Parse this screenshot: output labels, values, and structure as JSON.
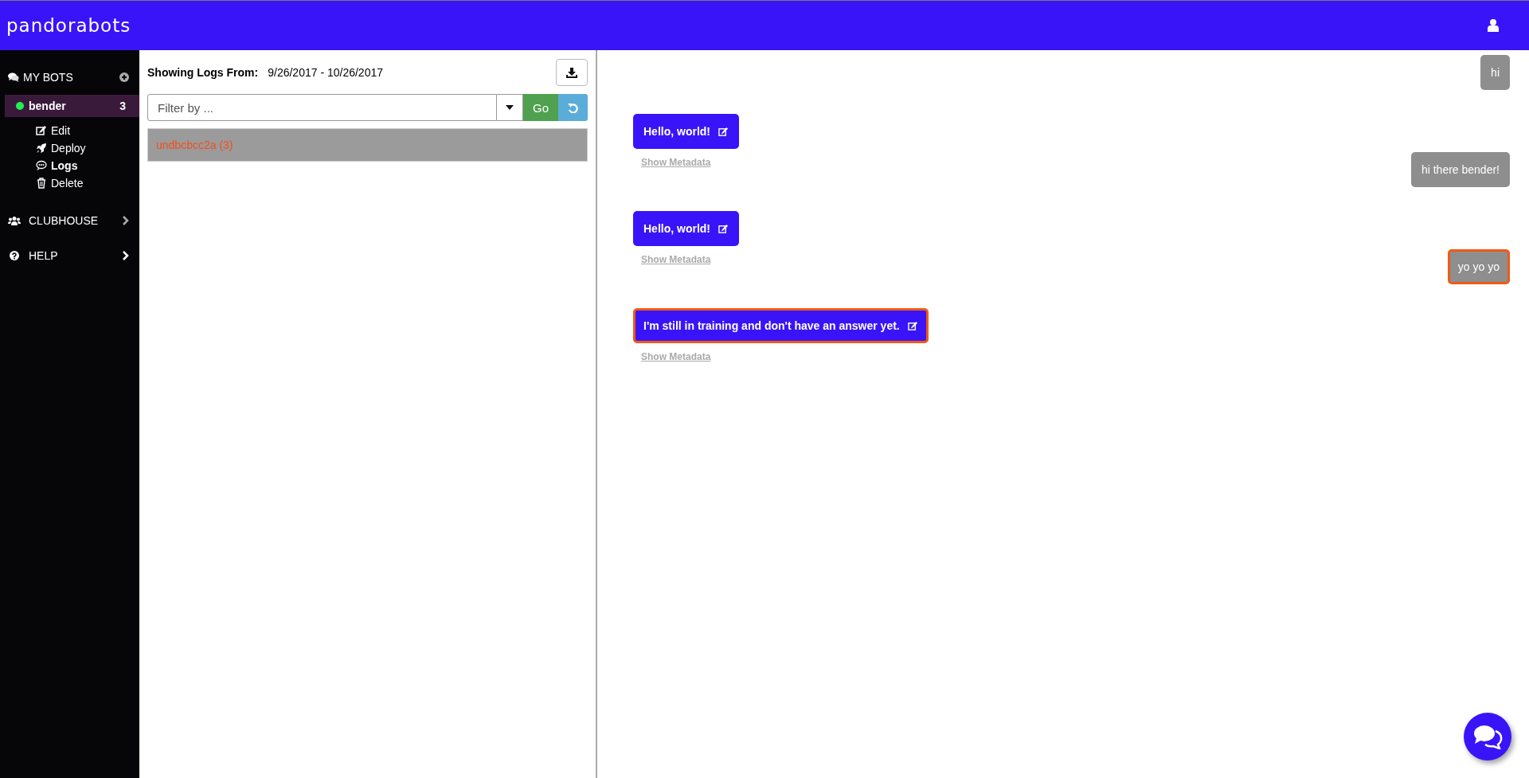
{
  "header": {
    "logo": "pandorabots"
  },
  "sidebar": {
    "my_bots": {
      "label": "MY BOTS",
      "bots": [
        {
          "name": "bender",
          "count": "3",
          "color": "#22ee55",
          "selected": true,
          "actions": [
            {
              "kind": "edit",
              "label": "Edit",
              "selected": false
            },
            {
              "kind": "deploy",
              "label": "Deploy",
              "selected": false
            },
            {
              "kind": "logs",
              "label": "Logs",
              "selected": true
            },
            {
              "kind": "delete",
              "label": "Delete",
              "selected": false
            }
          ]
        }
      ]
    },
    "sections": [
      {
        "kind": "clubhouse",
        "label": "CLUBHOUSE"
      },
      {
        "kind": "help",
        "label": "HELP"
      }
    ]
  },
  "logs": {
    "range_label": "Showing Logs From:",
    "range": "9/26/2017 - 10/26/2017",
    "filter": {
      "placeholder": "Filter by ..."
    },
    "go": "Go",
    "sessions": [
      {
        "label": "undbcbcc2a (3)",
        "selected": true
      }
    ]
  },
  "chat": {
    "messages": [
      {
        "kind": "user",
        "text": "hi",
        "highlighted": false
      },
      {
        "kind": "bot",
        "text": "Hello, world!",
        "link": "Show Metadata",
        "highlighted": false
      },
      {
        "kind": "user",
        "text": "hi there bender!",
        "highlighted": false
      },
      {
        "kind": "bot",
        "text": "Hello, world!",
        "link": "Show Metadata",
        "highlighted": false
      },
      {
        "kind": "user",
        "text": "yo yo yo",
        "highlighted": true
      },
      {
        "kind": "bot",
        "text": "I'm still in training and don't have an answer yet.",
        "link": "Show Metadata",
        "highlighted": true
      }
    ]
  }
}
